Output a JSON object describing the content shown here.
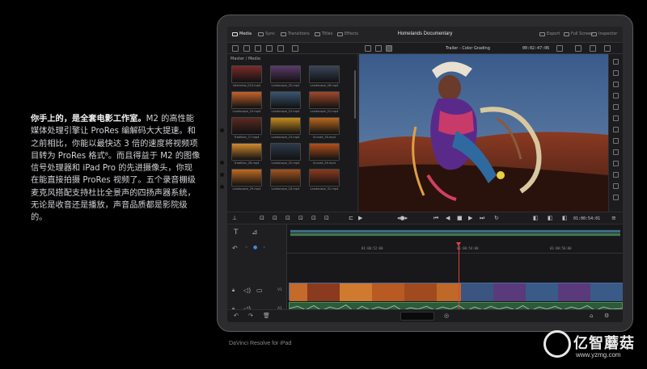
{
  "copy": {
    "lead": "你手上的，是全套电影工作室。",
    "body": "M2 的高性能媒体处理引擎让 ProRes 编解码大大提速。和之前相比，你能以最快达 3 倍的速度将视频项目转为 ProRes 格式⁸。而且得益于 M2 的图像信号处理器和 iPad Pro 的先进摄像头，你现在能直接拍摄 ProRes 视频了。五个录音棚级麦克风搭配支持杜比全景声的四扬声器系统，无论是收音还是播放，声音品质都是影院级的。"
  },
  "caption": "DaVinci Resolve for iPad",
  "app": {
    "tabs": [
      "Media",
      "Sync",
      "Transitions",
      "Titles",
      "Effects"
    ],
    "active_tab": "Media",
    "project_title": "Homelands Documentary",
    "right_tabs": [
      "Export",
      "Full Screen",
      "Inspector"
    ],
    "viewer_title": "Trailer - Color Grading",
    "timecode_top": "00:02:47:06",
    "media_path": "Master / Media",
    "clips": [
      {
        "name": "Interview_010.mp4",
        "color": "#7a2a2a"
      },
      {
        "name": "Landscape_20.mp4",
        "color": "#5a3a6a"
      },
      {
        "name": "Landscape_28.mp4",
        "color": "#3a4458"
      },
      {
        "name": "Landscape_19.mp4",
        "color": "#c4622a"
      },
      {
        "name": "Landscape_10.mp4",
        "color": "#3a5570"
      },
      {
        "name": "Landscape_22.mp4",
        "color": "#a0482a"
      },
      {
        "name": "Tradition_17.mp4",
        "color": "#5a2a22"
      },
      {
        "name": "Landscape_23.mp4",
        "color": "#c48a20"
      },
      {
        "name": "Sunset_18.mp4",
        "color": "#b8681e"
      },
      {
        "name": "Tradition_28.mp4",
        "color": "#d08a30"
      },
      {
        "name": "Landscape_31.mp4",
        "color": "#2e3a4a"
      },
      {
        "name": "Sunset_26.mp4",
        "color": "#b0501c"
      },
      {
        "name": "Landscape_29.mp4",
        "color": "#c06a22"
      },
      {
        "name": "Landscape_18.mp4",
        "color": "#a05420"
      },
      {
        "name": "Landscape_31.mp4",
        "color": "#8a3a1e"
      }
    ],
    "timecode_bottom": "01:00:54:01",
    "ruler_marks": [
      "01:00:52:00",
      "01:00:54:00",
      "01:00:56:00"
    ],
    "track_labels": {
      "video": "V1",
      "audio": "A1"
    },
    "colors": {
      "accent": "#e04040",
      "video_track": "#2c3b55",
      "audio_track": "#2f5a3a"
    }
  },
  "watermark": {
    "brand": "亿智蘑菇",
    "url": "www.yzmg.com"
  }
}
